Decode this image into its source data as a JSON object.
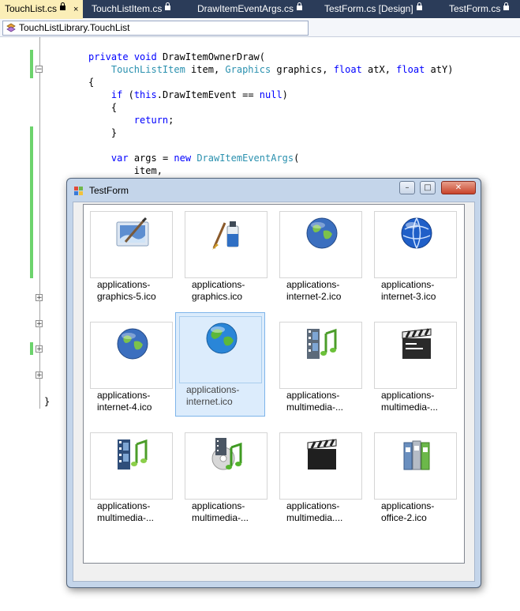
{
  "tabs": [
    {
      "label": "TouchList.cs",
      "active": true,
      "locked": true,
      "close": "×"
    },
    {
      "label": "TouchListItem.cs",
      "active": false,
      "locked": true
    },
    {
      "label": "DrawItemEventArgs.cs",
      "active": false,
      "locked": true
    },
    {
      "label": "TestForm.cs [Design]",
      "active": false,
      "locked": true
    },
    {
      "label": "TestForm.cs",
      "active": false,
      "locked": true
    }
  ],
  "navbar": {
    "member": "TouchListLibrary.TouchList"
  },
  "code": {
    "l1a": "private",
    "l1b": " ",
    "l1c": "void",
    "l1d": " DrawItemOwnerDraw(",
    "l2a": "    ",
    "l2b": "TouchListItem",
    "l2c": " item, ",
    "l2d": "Graphics",
    "l2e": " graphics, ",
    "l2f": "float",
    "l2g": " atX, ",
    "l2h": "float",
    "l2i": " atY)",
    "l3": "{",
    "l4a": "    ",
    "l4b": "if",
    "l4c": " (",
    "l4d": "this",
    "l4e": ".DrawItemEvent == ",
    "l4f": "null",
    "l4g": ")",
    "l5": "    {",
    "l6a": "        ",
    "l6b": "return",
    "l6c": ";",
    "l7": "    }",
    "l8a": "    ",
    "l8b": "var",
    "l8c": " args = ",
    "l8d": "new",
    "l8e": " ",
    "l8f": "DrawItemEventArgs",
    "l8g": "(",
    "l9": "        item,",
    "close_brace": "}"
  },
  "window": {
    "title": "TestForm",
    "min": "–",
    "max": "□",
    "close": "✕"
  },
  "items": [
    {
      "label": "applications-graphics-5.ico",
      "icon": "graphics-painting-icon"
    },
    {
      "label": "applications-graphics.ico",
      "icon": "paint-brush-icon"
    },
    {
      "label": "applications-internet-2.ico",
      "icon": "globe-icon"
    },
    {
      "label": "applications-internet-3.ico",
      "icon": "blue-globe-icon"
    },
    {
      "label": "applications-internet-4.ico",
      "icon": "globe-icon"
    },
    {
      "label": "applications-internet.ico",
      "icon": "earth-icon",
      "selected": true
    },
    {
      "label": "applications-multimedia-...",
      "icon": "film-music-icon"
    },
    {
      "label": "applications-multimedia-...",
      "icon": "clapperboard-icon"
    },
    {
      "label": "applications-multimedia-...",
      "icon": "film-music-icon"
    },
    {
      "label": "applications-multimedia-...",
      "icon": "disc-music-icon"
    },
    {
      "label": "applications-multimedia....",
      "icon": "clapperboard-icon"
    },
    {
      "label": "applications-office-2.ico",
      "icon": "binders-icon"
    }
  ],
  "colors": {
    "tab_bar": "#2b3c59",
    "active_tab": "#fbeeb7",
    "keyword": "#0000ff",
    "type": "#2b91af",
    "selection": "#dcecfc"
  }
}
